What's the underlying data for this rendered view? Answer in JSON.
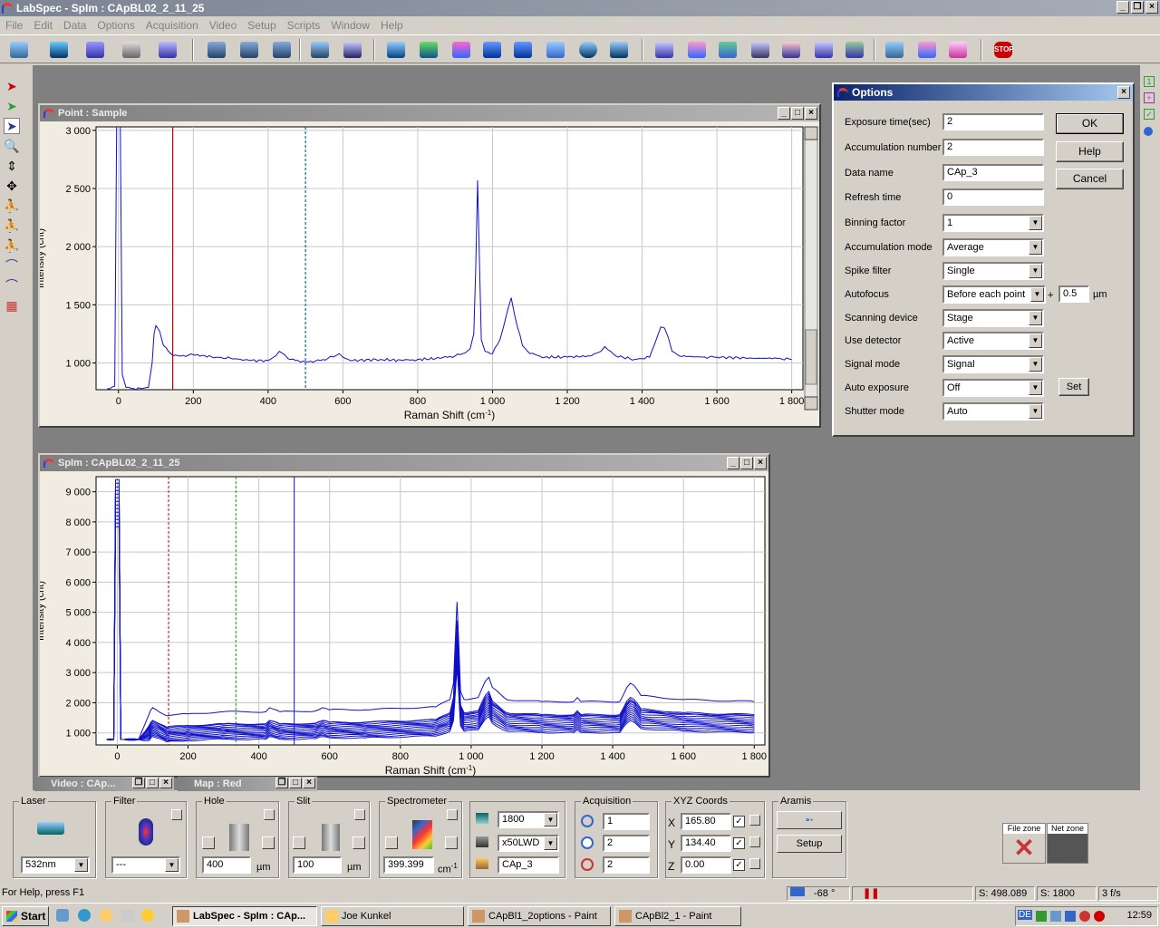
{
  "app": {
    "title": "LabSpec - SpIm : CApBL02_2_11_25"
  },
  "menu": [
    "File",
    "Edit",
    "Data",
    "Options",
    "Acquisition",
    "Video",
    "Setup",
    "Scripts",
    "Window",
    "Help"
  ],
  "point_window": {
    "title": "Point : Sample",
    "chart_data": {
      "type": "line",
      "xlabel": "Raman Shift (cm",
      "xlabel_sup": "-1",
      "xlabel_end": ")",
      "ylabel": "Intensity (cnt)",
      "xlim": [
        -60,
        1830
      ],
      "ylim": [
        770,
        3030
      ],
      "xticks": [
        0,
        200,
        400,
        600,
        800,
        1000,
        1200,
        1400,
        1600,
        1800
      ],
      "xtick_labels": [
        "0",
        "200",
        "400",
        "600",
        "800",
        "1 000",
        "1 200",
        "1 400",
        "1 600",
        "1 800"
      ],
      "yticks": [
        1000,
        1500,
        2000,
        2500,
        3000
      ],
      "ytick_labels": [
        "1 000",
        "1 500",
        "2 000",
        "2 500",
        "3 000"
      ],
      "cursors": [
        {
          "x": 145,
          "color": "#cc0000",
          "style": "solid"
        },
        {
          "x": 500,
          "color": "#006f8f",
          "style": "dashed"
        }
      ],
      "series": [
        {
          "color": "#1010c8",
          "x": [
            -30,
            -10,
            -5,
            0,
            5,
            10,
            20,
            40,
            60,
            80,
            90,
            95,
            100,
            105,
            110,
            120,
            140,
            160,
            200,
            260,
            300,
            350,
            400,
            420,
            430,
            440,
            460,
            500,
            540,
            560,
            580,
            590,
            600,
            620,
            700,
            760,
            800,
            860,
            900,
            920,
            940,
            950,
            955,
            960,
            965,
            970,
            980,
            1000,
            1020,
            1040,
            1050,
            1060,
            1080,
            1100,
            1140,
            1200,
            1260,
            1290,
            1300,
            1310,
            1330,
            1380,
            1420,
            1440,
            1450,
            1460,
            1470,
            1480,
            1500,
            1560,
            1600,
            1700,
            1760,
            1800
          ],
          "y": [
            780,
            800,
            3030,
            3030,
            3030,
            900,
            790,
            780,
            780,
            790,
            1000,
            1250,
            1320,
            1300,
            1270,
            1150,
            1080,
            1060,
            1070,
            1050,
            1040,
            1020,
            1020,
            1060,
            1100,
            1080,
            1030,
            1010,
            1020,
            1040,
            1060,
            1080,
            1050,
            1020,
            1030,
            1020,
            1030,
            1040,
            1060,
            1080,
            1120,
            1250,
            1800,
            2570,
            1900,
            1200,
            1100,
            1080,
            1200,
            1450,
            1560,
            1400,
            1150,
            1080,
            1050,
            1050,
            1060,
            1100,
            1140,
            1110,
            1060,
            1030,
            1050,
            1220,
            1310,
            1300,
            1220,
            1100,
            1060,
            1050,
            1050,
            1040,
            1040,
            1030
          ]
        }
      ]
    }
  },
  "spim_window": {
    "title": "SpIm : CApBL02_2_11_25",
    "chart_data": {
      "type": "line",
      "xlabel": "Raman Shift (cm",
      "xlabel_sup": "-1",
      "xlabel_end": ")",
      "ylabel": "Intensity (cnt)",
      "xlim": [
        -60,
        1830
      ],
      "ylim": [
        600,
        9500
      ],
      "xticks": [
        0,
        200,
        400,
        600,
        800,
        1000,
        1200,
        1400,
        1600,
        1800
      ],
      "xtick_labels": [
        "0",
        "200",
        "400",
        "600",
        "800",
        "1 000",
        "1 200",
        "1 400",
        "1 600",
        "1 800"
      ],
      "yticks": [
        1000,
        2000,
        3000,
        4000,
        5000,
        6000,
        7000,
        8000,
        9000
      ],
      "ytick_labels": [
        "1 000",
        "2 000",
        "3 000",
        "4 000",
        "5 000",
        "6 000",
        "7 000",
        "8 000",
        "9 000"
      ],
      "cursors": [
        {
          "x": 145,
          "color": "#cc0000",
          "style": "dashed"
        },
        {
          "x": 335,
          "color": "#00a000",
          "style": "dashed"
        },
        {
          "x": 500,
          "color": "#1010c8",
          "style": "solid"
        }
      ],
      "base_x": [
        -30,
        -10,
        -5,
        0,
        5,
        10,
        20,
        60,
        90,
        95,
        100,
        110,
        140,
        200,
        300,
        420,
        430,
        460,
        560,
        580,
        600,
        700,
        900,
        940,
        950,
        955,
        960,
        965,
        970,
        980,
        1020,
        1040,
        1050,
        1060,
        1100,
        1200,
        1290,
        1300,
        1310,
        1420,
        1440,
        1450,
        1460,
        1480,
        1600,
        1800
      ],
      "base_shape": [
        0,
        0,
        1,
        1,
        1,
        0.05,
        0,
        0,
        0.45,
        0.55,
        0.6,
        0.55,
        0.4,
        0.45,
        0.5,
        0.5,
        0.6,
        0.5,
        0.52,
        0.6,
        0.55,
        0.55,
        0.62,
        0.8,
        1.2,
        2.2,
        3.2,
        2.2,
        1.0,
        0.8,
        0.85,
        1.25,
        1.35,
        1.1,
        0.8,
        0.75,
        0.75,
        0.85,
        0.75,
        0.75,
        1.1,
        1.2,
        1.15,
        0.9,
        0.8,
        0.75
      ],
      "series_count": 14,
      "series_color": "#1010c8"
    }
  },
  "options_dialog": {
    "title": "Options",
    "fields": [
      {
        "label": "Exposure time(sec)",
        "value": "2",
        "kind": "input"
      },
      {
        "label": "Accumulation number",
        "value": "2",
        "kind": "input"
      },
      {
        "label": "Data name",
        "value": "CAp_3",
        "kind": "input"
      },
      {
        "label": "Refresh time",
        "value": "0",
        "kind": "input"
      },
      {
        "label": "Binning factor",
        "value": "1",
        "kind": "select"
      },
      {
        "label": "Accumulation mode",
        "value": "Average",
        "kind": "select"
      },
      {
        "label": "Spike filter",
        "value": "Single",
        "kind": "select"
      },
      {
        "label": "Autofocus",
        "value": "Before each point",
        "kind": "select"
      },
      {
        "label": "Scanning device",
        "value": "Stage",
        "kind": "select"
      },
      {
        "label": "Use detector",
        "value": "Active",
        "kind": "select"
      },
      {
        "label": "Signal mode",
        "value": "Signal",
        "kind": "select"
      },
      {
        "label": "Auto exposure",
        "value": "Off",
        "kind": "select"
      },
      {
        "label": "Shutter mode",
        "value": "Auto",
        "kind": "select"
      }
    ],
    "autofocus_plus": "+",
    "autofocus_offset": "0.5",
    "autofocus_unit": "µm",
    "ok": "OK",
    "help": "Help",
    "cancel": "Cancel",
    "set": "Set"
  },
  "min_windows": {
    "video": "Video : CAp...",
    "map": "Map : Red"
  },
  "bottom": {
    "laser": {
      "label": "Laser",
      "value": "532nm"
    },
    "filter": {
      "label": "Filter",
      "value": "---"
    },
    "hole": {
      "label": "Hole",
      "value": "400",
      "unit": "µm"
    },
    "slit": {
      "label": "Slit",
      "value": "100",
      "unit": "µm"
    },
    "spectrometer": {
      "label": "Spectrometer",
      "value": "399.399",
      "unit": "cm",
      "unit_sup": "-1"
    },
    "grating": {
      "value": "1800"
    },
    "objective": {
      "value": "x50LWD"
    },
    "dataname": {
      "value": "CAp_3"
    },
    "acquisition": {
      "label": "Acquisition",
      "v1": "1",
      "v2": "2",
      "v3": "2"
    },
    "xyz": {
      "label": "XYZ Coords",
      "x_label": "X",
      "x": "165.80",
      "y_label": "Y",
      "y": "134.40",
      "z_label": "Z",
      "z": "0.00"
    },
    "aramis": {
      "label": "Aramis",
      "setup": "Setup"
    },
    "filezone": "File zone",
    "netzone": "Net zone"
  },
  "status": {
    "help": "For Help, press F1",
    "temp": "-68 °",
    "pos": "S: 498.089",
    "grating": "S: 1800",
    "fps": "3 f/s"
  },
  "taskbar": {
    "start": "Start",
    "tasks": [
      "LabSpec - SpIm : CAp...",
      "Joe Kunkel",
      "CApBl1_2options - Paint",
      "CApBl2_1 - Paint"
    ],
    "lang": "DE",
    "clock": "12:59"
  }
}
